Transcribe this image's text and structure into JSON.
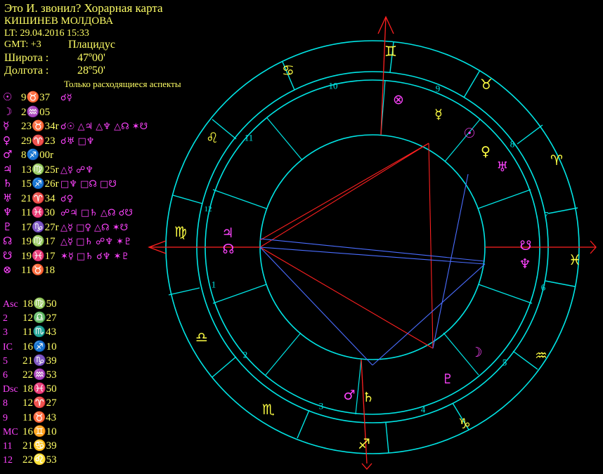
{
  "header": {
    "title": "Это И. звонил? Хорарная карта",
    "place": "КИШИНЕВ МОЛДОВА",
    "local_time": "LT: 29.04.2016  15:33",
    "gmt": "GMT: +3",
    "house_system": "Плацидус",
    "latitude_label": "Широта :",
    "latitude_value": "47º00'",
    "longitude_label": "Долгота :",
    "longitude_value": "28º50'",
    "aspects_note": "Только расходящиеся аспекты"
  },
  "planets": [
    {
      "symbol": "☉",
      "position": "9♉37",
      "aspects": "☌☿"
    },
    {
      "symbol": "☽",
      "position": "2♒05",
      "aspects": ""
    },
    {
      "symbol": "☿",
      "position": "23♉34r",
      "aspects": "☌☉ △♃ △♆ △☊ ✶☋"
    },
    {
      "symbol": "♀",
      "position": "29♈23",
      "aspects": "☌♅ □♆"
    },
    {
      "symbol": "♂",
      "position": "8♐00r",
      "aspects": ""
    },
    {
      "symbol": "♃",
      "position": "13♍25r",
      "aspects": "△☿ ☍♆"
    },
    {
      "symbol": "♄",
      "position": "15♐26r",
      "aspects": "□♆ □☊ □☋"
    },
    {
      "symbol": "♅",
      "position": "21♈34",
      "aspects": "☌♀"
    },
    {
      "symbol": "♆",
      "position": "11♓30",
      "aspects": "☍♃ □♄ △☊ ☌☋"
    },
    {
      "symbol": "♇",
      "position": "17♑27r",
      "aspects": "△☿ □♀ △☊ ✶☋"
    },
    {
      "symbol": "☊",
      "position": "19♍17",
      "aspects": "△☿ □♄ ☍♆ ✶♇"
    },
    {
      "symbol": "☋",
      "position": "19♓17",
      "aspects": "✶☿ □♄ ☌♆ ✶♇"
    },
    {
      "symbol": "⊗",
      "position": "11♉18",
      "aspects": ""
    }
  ],
  "cusps": [
    {
      "label": "Asc",
      "value": "18♍50"
    },
    {
      "label": "2",
      "value": "12♎27"
    },
    {
      "label": "3",
      "value": "11♏43"
    },
    {
      "label": "IC",
      "value": "16♐10"
    },
    {
      "label": "5",
      "value": "21♑39"
    },
    {
      "label": "6",
      "value": "22♒53"
    },
    {
      "label": "Dsc",
      "value": "18♓50"
    },
    {
      "label": "8",
      "value": "12♈27"
    },
    {
      "label": "9",
      "value": "11♉43"
    },
    {
      "label": "MC",
      "value": "16♊10"
    },
    {
      "label": "11",
      "value": "21♋39"
    },
    {
      "label": "12",
      "value": "22♌53"
    }
  ],
  "wheel": {
    "sign_labels": [
      "♊",
      "♉",
      "♈",
      "♓",
      "♒",
      "♑",
      "♐",
      "♏",
      "♎",
      "♍",
      "♌",
      "♋"
    ],
    "house_numbers": [
      "1",
      "2",
      "3",
      "4",
      "5",
      "6",
      "7",
      "8",
      "9",
      "10",
      "11",
      "12"
    ],
    "planet_glyphs": [
      "⊗",
      "☿",
      "☉",
      "♀",
      "♅",
      "♃",
      "☊",
      "☋",
      "♆",
      "☽",
      "♇",
      "♂",
      "♄"
    ],
    "colors": {
      "ring": "#00e5e5",
      "axis": "#ff2020",
      "sign": "#ffff44",
      "planet_magenta": "#ff44ff",
      "planet_yellow": "#ffff44",
      "aspect_red": "#ff2020",
      "aspect_blue": "#4a6dff"
    }
  }
}
